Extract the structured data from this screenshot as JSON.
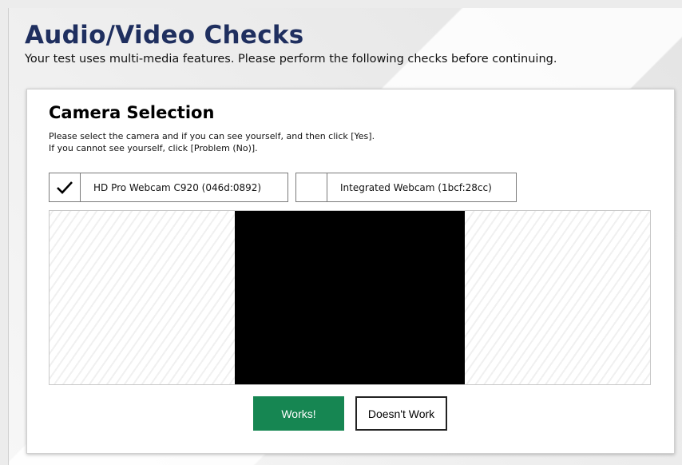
{
  "header": {
    "title": "Audio/Video Checks",
    "subtitle": "Your test uses multi-media features. Please perform the following checks before continuing."
  },
  "camera_section": {
    "title": "Camera Selection",
    "instructions": [
      "Please select the camera and if you can see yourself, and then click [Yes].",
      "If you cannot see yourself, click [Problem (No)]."
    ],
    "options": [
      {
        "label": "HD Pro Webcam C920 (046d:0892)",
        "selected": true,
        "icon": "checkmark-icon"
      },
      {
        "label": "Integrated Webcam (1bcf:28cc)",
        "selected": false
      }
    ]
  },
  "actions": {
    "works_label": "Works!",
    "doesnt_work_label": "Doesn't Work"
  },
  "colors": {
    "title": "#1f2f5f",
    "works_button": "#168652",
    "video_feed": "#000000"
  }
}
